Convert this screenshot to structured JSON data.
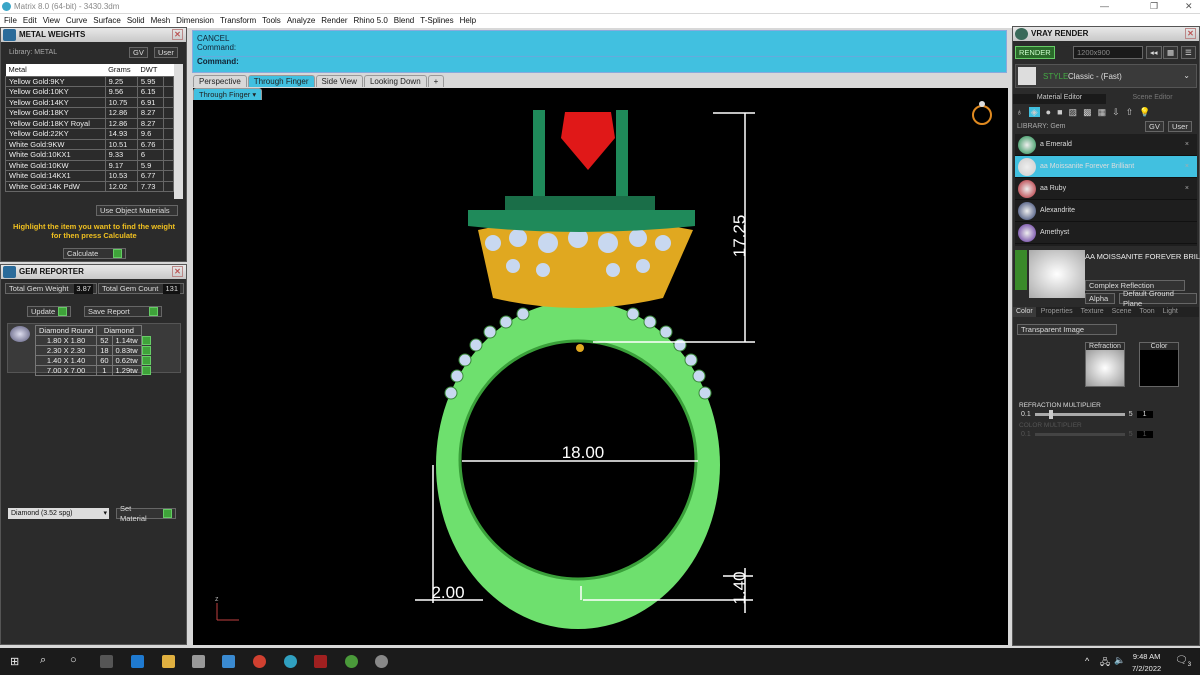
{
  "window": {
    "title": "Matrix 8.0 (64-bit) - 3430.3dm"
  },
  "menu": [
    "File",
    "Edit",
    "View",
    "Curve",
    "Surface",
    "Solid",
    "Mesh",
    "Dimension",
    "Transform",
    "Tools",
    "Analyze",
    "Render",
    "Rhino 5.0",
    "Blend",
    "T-Splines",
    "Help"
  ],
  "metal_weights": {
    "title": "METAL WEIGHTS",
    "library": "Library: METAL",
    "gv": "GV",
    "user": "User",
    "columns": [
      "Metal",
      "Grams",
      "DWT"
    ],
    "rows": [
      [
        "Yellow Gold:9KY",
        "9.25",
        "5.95"
      ],
      [
        "Yellow Gold:10KY",
        "9.56",
        "6.15"
      ],
      [
        "Yellow Gold:14KY",
        "10.75",
        "6.91"
      ],
      [
        "Yellow Gold:18KY",
        "12.86",
        "8.27"
      ],
      [
        "Yellow Gold:18KY Royal",
        "12.86",
        "8.27"
      ],
      [
        "Yellow Gold:22KY",
        "14.93",
        "9.6"
      ],
      [
        "White Gold:9KW",
        "10.51",
        "6.76"
      ],
      [
        "White Gold:10KX1",
        "9.33",
        "6"
      ],
      [
        "White Gold:10KW",
        "9.17",
        "5.9"
      ],
      [
        "White Gold:14KX1",
        "10.53",
        "6.77"
      ],
      [
        "White Gold:14K PdW",
        "12.02",
        "7.73"
      ]
    ],
    "use_object_materials": "Use Object Materials",
    "hint": "Highlight the item you want to find the weight for then press Calculate",
    "calculate": "Calculate"
  },
  "gem_reporter": {
    "title": "GEM REPORTER",
    "total_weight_label": "Total Gem Weight",
    "total_weight": "3.87",
    "total_count_label": "Total Gem Count",
    "total_count": "131",
    "update": "Update",
    "save_report": "Save Report",
    "header_shape": "Diamond Round",
    "header_type": "Diamond",
    "rows": [
      [
        "1.80 X 1.80",
        "52",
        "1.14tw"
      ],
      [
        "2.30 X 2.30",
        "18",
        "0.83tw"
      ],
      [
        "1.40 X 1.40",
        "60",
        "0.62tw"
      ],
      [
        "7.00 X 7.00",
        "1",
        "1.29tw"
      ]
    ],
    "material_select": "Diamond    (3.52 spg)",
    "set_material": "Set Material"
  },
  "command": {
    "line1": "CANCEL",
    "line2": "Command:",
    "prompt": "Command:"
  },
  "viewport_tabs": [
    "Perspective",
    "Through Finger",
    "Side View",
    "Looking Down",
    "+"
  ],
  "active_viewport": "Through Finger",
  "dimensions": {
    "height": "17.25",
    "inner": "18.00",
    "width": "2.00",
    "thickness": "1.40"
  },
  "axis": {
    "z": "z"
  },
  "vray": {
    "title": "VRAY RENDER",
    "render": "RENDER",
    "resolution": "1200x900",
    "style_label": "STYLE",
    "style": "Classic - (Fast)",
    "tabs": [
      "Material Editor",
      "Scene Editor"
    ],
    "library": "LIBRARY: Gem",
    "gv": "GV",
    "user": "User",
    "materials": [
      {
        "name": "a Emerald",
        "color": "#1a8a4a"
      },
      {
        "name": "aa Moissanite Forever Brilliant",
        "color": "#cccccc"
      },
      {
        "name": "aa Ruby",
        "color": "#b0202a"
      },
      {
        "name": "Alexandrite",
        "color": "#2a3a6a"
      },
      {
        "name": "Amethyst",
        "color": "#5a2a9a"
      }
    ],
    "selected_name": "AA MOISSANITE FOREVER BRILLIANT",
    "reflection": "Complex Reflection",
    "alpha": "Alpha",
    "ground": "Default Ground Plane",
    "subtabs": [
      "Color",
      "Properties",
      "Texture",
      "Scene",
      "Toon",
      "Light"
    ],
    "image_mode": "Transparent Image",
    "refraction": "Refraction",
    "color": "Color",
    "refraction_multiplier": "REFRACTION MULTIPLIER",
    "rm_min": "0.1",
    "rm_max": "5",
    "rm_value": "1",
    "color_multiplier": "COLOR MULTIPLIER",
    "cm_min": "0.1",
    "cm_max": "5",
    "cm_value": "1"
  },
  "taskbar": {
    "time": "9:48 AM",
    "date": "7/2/2022",
    "notifications": "3"
  }
}
